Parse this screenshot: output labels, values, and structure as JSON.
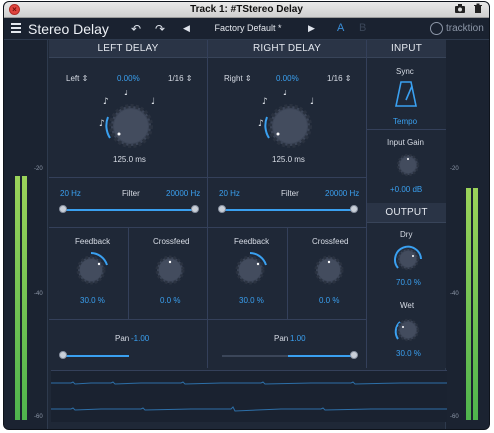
{
  "window": {
    "title": "Track 1: #TStereo Delay"
  },
  "toolbar": {
    "plugin_name": "Stereo Delay",
    "undo_icon": "undo-icon",
    "redo_icon": "redo-icon",
    "preset_name": "Factory Default *",
    "ab_a": "A",
    "ab_b": "B",
    "logo_text": "tracktion"
  },
  "meters": {
    "left_labels": [
      "-20",
      "-40",
      "-60"
    ],
    "right_labels": [
      "-20",
      "-40",
      "-60"
    ]
  },
  "left_delay": {
    "header": "LEFT DELAY",
    "channel": "Left",
    "offset": "0.00%",
    "note": "1/16",
    "time": "125.0 ms",
    "filter_low": "20 Hz",
    "filter_label": "Filter",
    "filter_high": "20000 Hz",
    "feedback_label": "Feedback",
    "feedback_value": "30.0 %",
    "crossfeed_label": "Crossfeed",
    "crossfeed_value": "0.0 %",
    "pan_label": "Pan",
    "pan_value": "-1.00"
  },
  "right_delay": {
    "header": "RIGHT DELAY",
    "channel": "Right",
    "offset": "0.00%",
    "note": "1/16",
    "time": "125.0 ms",
    "filter_low": "20 Hz",
    "filter_label": "Filter",
    "filter_high": "20000 Hz",
    "feedback_label": "Feedback",
    "feedback_value": "30.0 %",
    "crossfeed_label": "Crossfeed",
    "crossfeed_value": "0.0 %",
    "pan_label": "Pan",
    "pan_value": "1.00"
  },
  "input": {
    "header": "INPUT",
    "sync_label": "Sync",
    "sync_mode": "Tempo",
    "gain_label": "Input Gain",
    "gain_value": "+0.00 dB"
  },
  "output": {
    "header": "OUTPUT",
    "dry_label": "Dry",
    "dry_value": "70.0 %",
    "wet_label": "Wet",
    "wet_value": "30.0 %"
  },
  "colors": {
    "accent": "#3aa0f0",
    "background": "#1f2837",
    "meter_green": "#5ec050"
  }
}
